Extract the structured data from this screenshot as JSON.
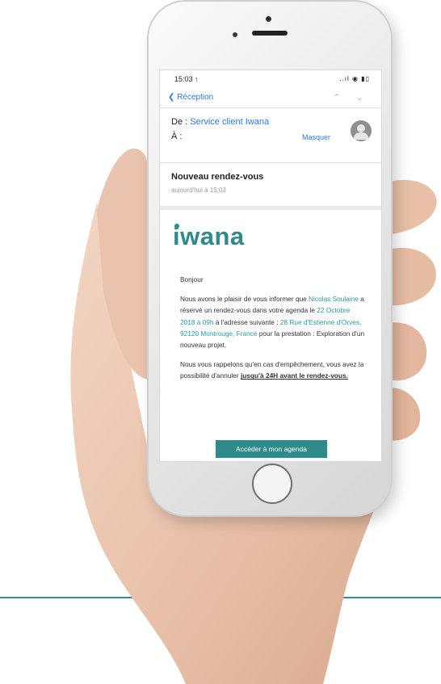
{
  "status_bar": {
    "time": "15:03 ↑",
    "icons": "..ıl ◉ ▮▯"
  },
  "nav": {
    "back_label": "Réception",
    "arrows": "⌃ ⌄"
  },
  "header": {
    "from_label": "De :",
    "from_name": "Service client Iwana",
    "to_label": "À :",
    "hide_label": "Masquer"
  },
  "subject": {
    "title": "Nouveau rendez-vous",
    "date": "aujourd'hui à 15:03"
  },
  "email": {
    "logo": "iwana",
    "greeting": "Bonjour",
    "p1_a": "Nous avons le plaisir de vous informer que",
    "p1_name": "Nicolas Soulaine",
    "p1_b": "a réservé un rendez-vous dans votre agenda le",
    "p1_date": "22 Octobre 2018 à 09h",
    "p1_c": "à l'adresse suivante :",
    "p1_addr": "28 Rue d'Estienne d'Orves, 92120 Montrouge, France",
    "p1_d": "pour la prestation : Exploration d'un nouveau projet.",
    "p2_a": "Nous vous rappelons qu'en cas d'empêchement, vous avez la possibilité d'annuler",
    "p2_u": "jusqu'à 24H avant le rendez-vous.",
    "button": "Accéder à mon agenda"
  }
}
